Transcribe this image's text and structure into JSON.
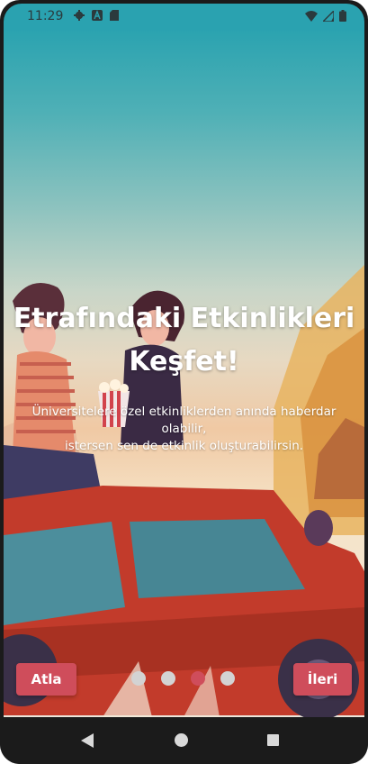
{
  "status_bar": {
    "time": "11:29",
    "left_icons": [
      "gear-icon",
      "a-badge-icon",
      "sd-card-icon"
    ],
    "right_icons": [
      "wifi-icon",
      "signal-icon",
      "battery-icon"
    ]
  },
  "onboarding": {
    "title_line1": "Etrafındaki Etkinlikleri",
    "title_line2": "Keşfet!",
    "subtitle_line1": "Üniversitelere özel etkinliklerden anında haberdar",
    "subtitle_line2": "olabilir,",
    "subtitle_line3": "istersen sen de etkinlik oluşturabilirsin.",
    "page_index": 3,
    "page_count": 4
  },
  "buttons": {
    "skip_label": "Atla",
    "next_label": "İleri"
  },
  "colors": {
    "accent": "#cf4d5b",
    "dot_inactive": "#d3d3d3",
    "sky_top": "#2ba3b0"
  },
  "nav_bar": {
    "icons": [
      "back-icon",
      "home-icon",
      "recents-icon"
    ]
  }
}
